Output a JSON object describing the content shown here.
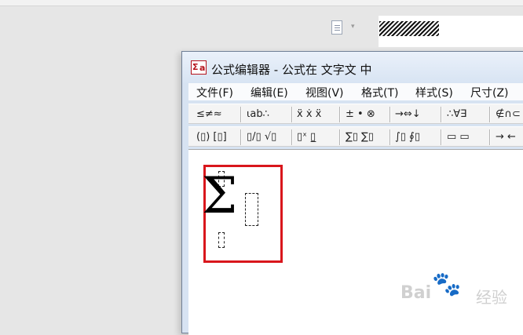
{
  "window": {
    "title": "公式编辑器 - 公式在 文字文 中"
  },
  "app_icon": {
    "glyph_left": "Σ",
    "glyph_right": "a"
  },
  "menu": [
    {
      "name": "menu-file",
      "label": "文件(F)"
    },
    {
      "name": "menu-edit",
      "label": "编辑(E)"
    },
    {
      "name": "menu-view",
      "label": "视图(V)"
    },
    {
      "name": "menu-format",
      "label": "格式(T)"
    },
    {
      "name": "menu-style",
      "label": "样式(S)"
    },
    {
      "name": "menu-size",
      "label": "尺寸(Z)"
    }
  ],
  "toolbar1": [
    {
      "name": "relations-palette-button",
      "label": "≤≠≈"
    },
    {
      "name": "spaces-ellipses-palette-button",
      "label": "⍳ab∴"
    },
    {
      "name": "embellishments-palette-button",
      "label": "ẍ ẋ ẍ"
    },
    {
      "name": "operators-palette-button",
      "label": "± • ⊗"
    },
    {
      "name": "arrows-palette-button",
      "label": "→⇔↓"
    },
    {
      "name": "logic-palette-button",
      "label": "∴∀∃"
    },
    {
      "name": "sets-palette-button",
      "label": "∉∩⊂"
    }
  ],
  "toolbar2": [
    {
      "name": "fence-templates-button",
      "label": "(▯) [▯]"
    },
    {
      "name": "fraction-radical-templates-button",
      "label": "▯/▯ √▯"
    },
    {
      "name": "subscript-templates-button",
      "label": "▯ˣ ▯̲"
    },
    {
      "name": "summation-templates-button",
      "label": "∑▯ ∑▯"
    },
    {
      "name": "integral-templates-button",
      "label": "∫▯ ∮▯"
    },
    {
      "name": "underbar-overbar-templates-button",
      "label": "▭ ▭"
    },
    {
      "name": "labeled-arrow-templates-button",
      "label": "→ ←"
    }
  ],
  "icons": {
    "background_doc": "document-icon",
    "background_dropdown": "▾"
  },
  "watermark": {
    "brand": "Bai",
    "suffix": "经验",
    "paw": "🐾"
  },
  "colors": {
    "highlight": "#d9161c",
    "window_frame": "#d7e3f2",
    "accent_icon": "#b5121b"
  }
}
